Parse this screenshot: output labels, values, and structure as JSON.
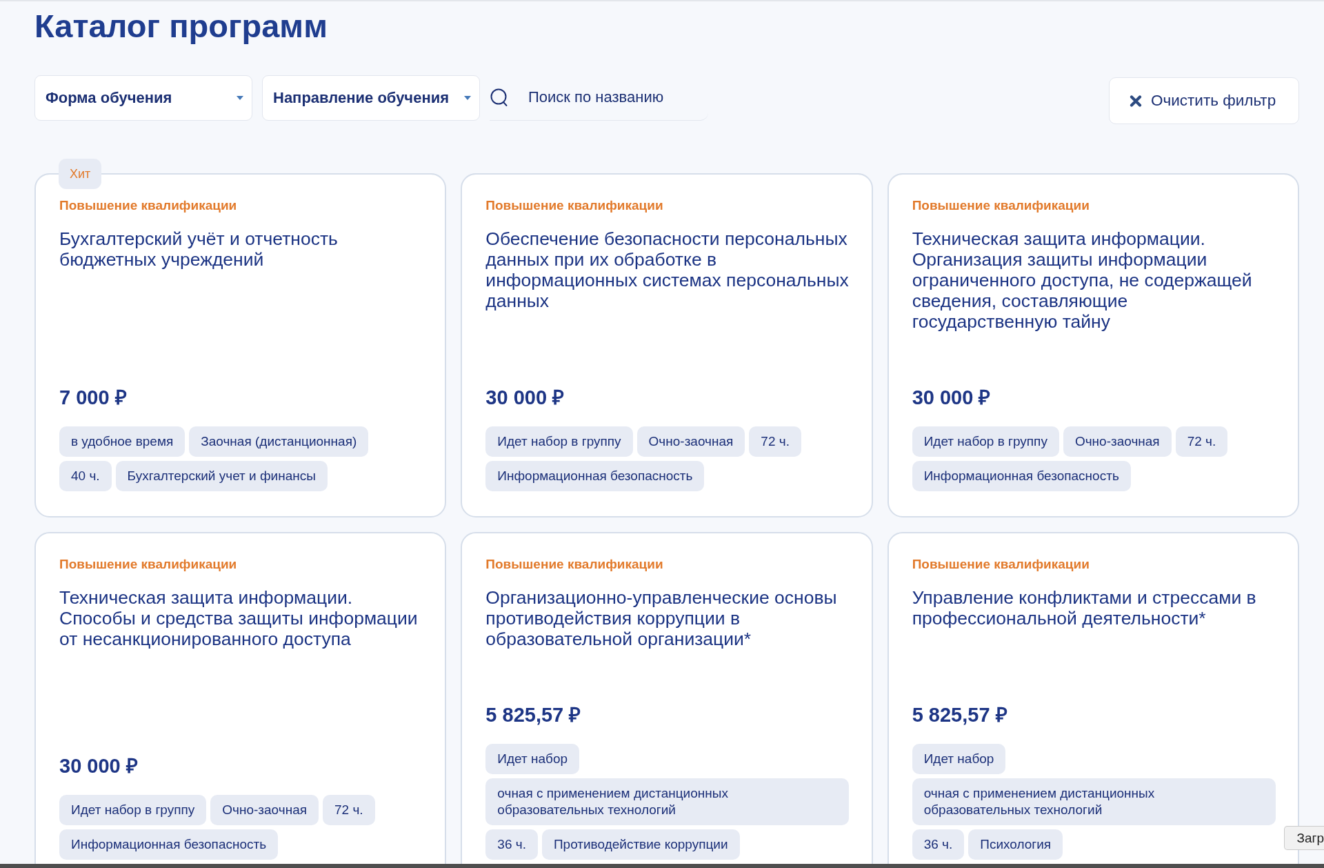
{
  "page": {
    "title": "Каталог программ"
  },
  "filters": {
    "dropdowns": [
      {
        "label": "Форма обучения"
      },
      {
        "label": "Направление обучения"
      }
    ],
    "search": {
      "placeholder": "Поиск по названию"
    },
    "clear_button": {
      "label": "Очистить фильтр"
    }
  },
  "programs": [
    {
      "badge": "Хит",
      "category": "Повышение квалификации",
      "title": "Бухгалтерский учёт и отчетность бюджетных учреждений",
      "price": "7 000 ₽",
      "tags": [
        "в удобное время",
        "Заочная (дистанционная)",
        "40 ч.",
        "Бухгалтерский учет и финансы"
      ]
    },
    {
      "category": "Повышение квалификации",
      "title": "Обеспечение безопасности персональных данных при их обработке в информационных системах персональных данных",
      "price": "30 000 ₽",
      "tags": [
        "Идет набор в группу",
        "Очно-заочная",
        "72 ч.",
        "Информационная безопасность"
      ]
    },
    {
      "category": "Повышение квалификации",
      "title": "Техническая защита информации. Организация защиты информации ограниченного доступа, не содержащей сведения, составляющие государственную тайну",
      "price": "30 000 ₽",
      "tags": [
        "Идет набор в группу",
        "Очно-заочная",
        "72 ч.",
        "Информационная безопасность"
      ]
    },
    {
      "category": "Повышение квалификации",
      "title": "Техническая защита информации. Способы и средства защиты информации от несанкционированного доступа",
      "price": "30 000 ₽",
      "tags": [
        "Идет набор в группу",
        "Очно-заочная",
        "72 ч.",
        "Информационная безопасность"
      ]
    },
    {
      "category": "Повышение квалификации",
      "title": "Организационно-управленческие основы противодействия коррупции в образовательной организации*",
      "price": "5 825,57 ₽",
      "tags": [
        "Идет набор",
        "очная с применением дистанционных образовательных технологий",
        "36 ч.",
        "Противодействие коррупции"
      ]
    },
    {
      "category": "Повышение квалификации",
      "title": "Управление конфликтами и стрессами в профессиональной деятельности*",
      "price": "5 825,57 ₽",
      "tags": [
        "Идет набор",
        "очная с применением дистанционных образовательных технологий",
        "36 ч.",
        "Психология"
      ]
    }
  ],
  "tooltip": {
    "text": "Загр"
  }
}
